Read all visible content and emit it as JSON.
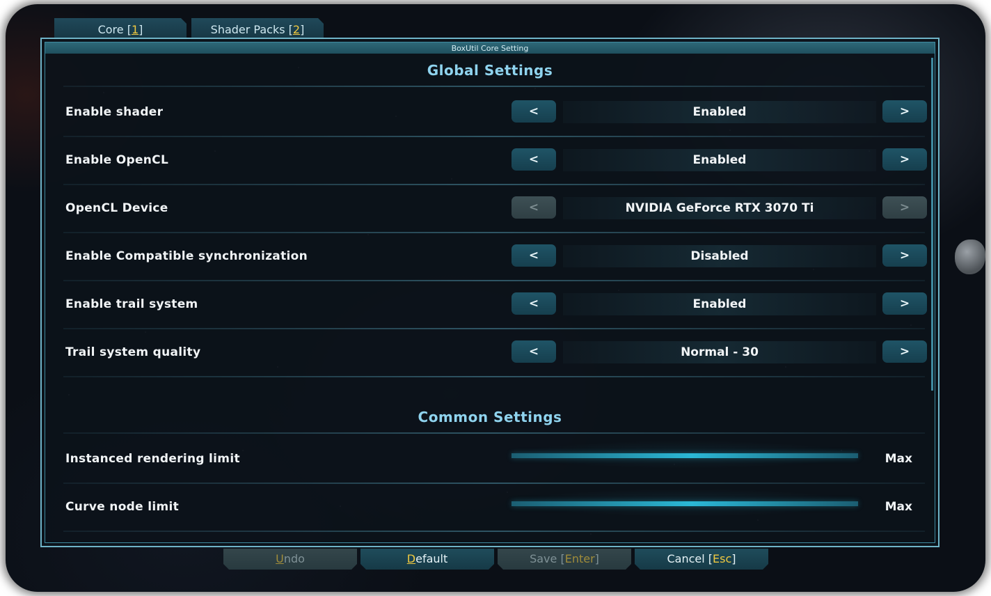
{
  "tabs": [
    {
      "text": "Core [",
      "hotkey": "1",
      "suffix": "]"
    },
    {
      "text": "Shader Packs [",
      "hotkey": "2",
      "suffix": "]"
    }
  ],
  "window": {
    "title": "BoxUtil Core Setting"
  },
  "sections": {
    "global": "Global Settings",
    "common": "Common Settings"
  },
  "global_settings": [
    {
      "label": "Enable shader",
      "value": "Enabled",
      "enabled": true
    },
    {
      "label": "Enable OpenCL",
      "value": "Enabled",
      "enabled": true
    },
    {
      "label": "OpenCL Device",
      "value": "NVIDIA GeForce RTX 3070 Ti",
      "enabled": false
    },
    {
      "label": "Enable Compatible synchronization",
      "value": "Disabled",
      "enabled": true
    },
    {
      "label": "Enable trail system",
      "value": "Enabled",
      "enabled": true
    },
    {
      "label": "Trail system quality",
      "value": "Normal - 30",
      "enabled": true
    }
  ],
  "common_settings": [
    {
      "label": "Instanced rendering limit",
      "value": "Max",
      "level": 1.0
    },
    {
      "label": "Curve node limit",
      "value": "Max",
      "level": 1.0
    }
  ],
  "arrows": {
    "prev": "<",
    "next": ">"
  },
  "buttons": {
    "undo": {
      "hotkey": "U",
      "rest": "ndo",
      "enabled": false
    },
    "default": {
      "hotkey": "D",
      "rest": "efault",
      "enabled": true
    },
    "save": {
      "text": "Save [",
      "hotkey": "Enter",
      "suffix": "]",
      "enabled": false
    },
    "cancel": {
      "text": "Cancel [",
      "hotkey": "Esc",
      "suffix": "]",
      "enabled": true
    }
  },
  "colors": {
    "accent": "#8fd3ee",
    "hotkey": "#f0c940",
    "button": "#1f5466",
    "slider": "#2bb8d6"
  }
}
